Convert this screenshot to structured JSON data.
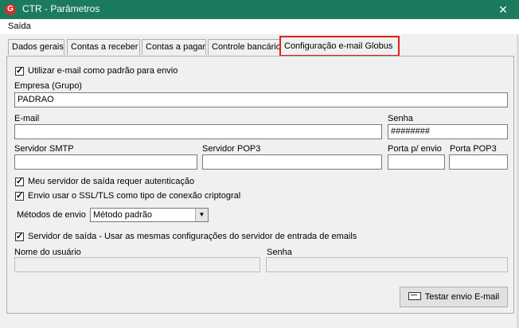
{
  "window": {
    "app_icon": "G",
    "title": "CTR - Parâmetros",
    "close_glyph": "✕"
  },
  "menu": {
    "items": [
      "Saída"
    ]
  },
  "tabs": [
    {
      "label": "Dados gerais"
    },
    {
      "label": "Contas a receber"
    },
    {
      "label": "Contas a pagar"
    },
    {
      "label": "Controle bancário"
    },
    {
      "label": "Configuração e-mail Globus",
      "active": true
    }
  ],
  "form": {
    "use_default_checkbox": {
      "label": "Utilizar e-mail como padrão para envio",
      "checked": true
    },
    "empresa": {
      "label": "Empresa (Grupo)",
      "value": "PADRAO"
    },
    "email": {
      "label": "E-mail",
      "value": ""
    },
    "senha": {
      "label": "Senha",
      "value": "########"
    },
    "smtp": {
      "label": "Servidor SMTP",
      "value": ""
    },
    "pop3": {
      "label": "Servidor POP3",
      "value": ""
    },
    "porta_envio": {
      "label": "Porta p/ envio",
      "value": ""
    },
    "porta_pop3": {
      "label": "Porta POP3",
      "value": ""
    },
    "auth_checkbox": {
      "label": "Meu servidor de saída requer autenticação",
      "checked": true
    },
    "ssl_checkbox": {
      "label": "Envio usar o SSL/TLS como tipo de conexão criptogral",
      "checked": true
    },
    "metodos": {
      "label": "Métodos de envio",
      "value": "Método padrão"
    },
    "same_config_checkbox": {
      "label": "Servidor de saída - Usar as mesmas configurações do servidor de entrada de emails",
      "checked": true
    },
    "usuario": {
      "label": "Nome do usuário",
      "value": ""
    },
    "senha2": {
      "label": "Senha",
      "value": ""
    },
    "test_button": {
      "label": "Testar envio E-mail",
      "icon": "envelope-icon"
    }
  },
  "colors": {
    "titlebar": "#1c7a5f",
    "active_tab_outline": "#e0201f",
    "panel_bg": "#f0f0f0"
  }
}
